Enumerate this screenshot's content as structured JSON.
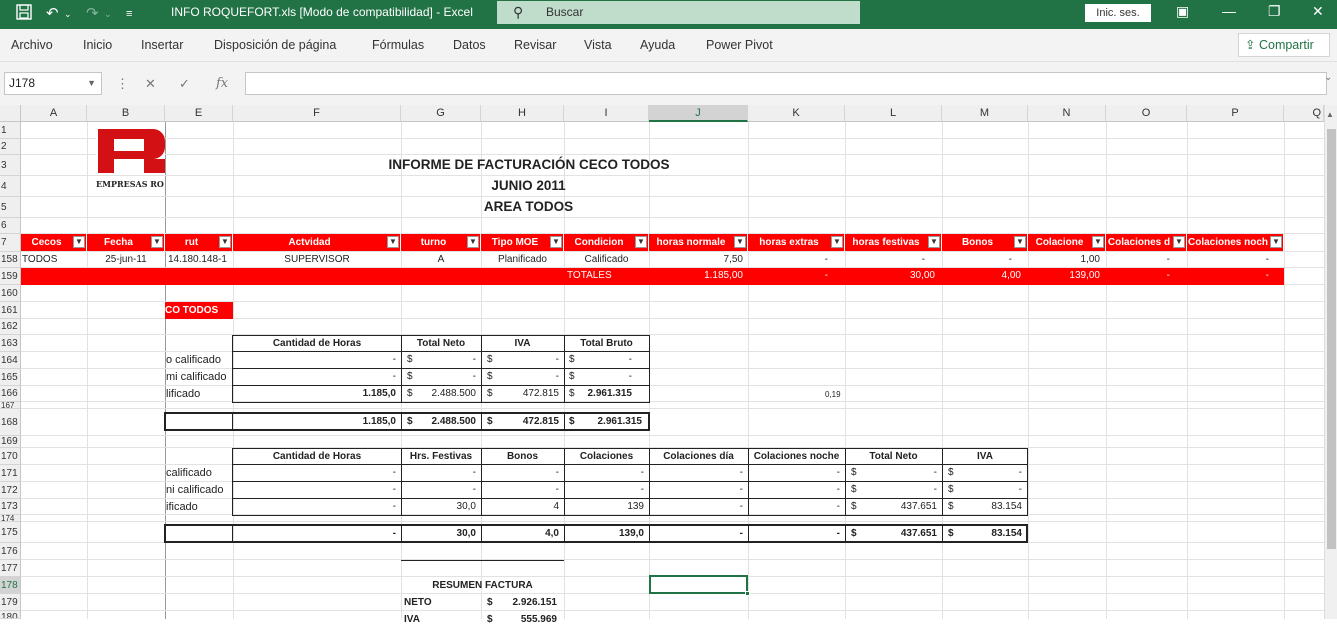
{
  "titlebar": {
    "title": "INFO ROQUEFORT.xls  [Modo de compatibilidad]  -  Excel",
    "search_placeholder": "Buscar",
    "signin": "Inic. ses.",
    "accent": "#217346"
  },
  "menu": [
    "Archivo",
    "Inicio",
    "Insertar",
    "Disposición de página",
    "Fórmulas",
    "Datos",
    "Revisar",
    "Vista",
    "Ayuda",
    "Power Pivot"
  ],
  "share": "Compartir",
  "formula_bar": {
    "cell_ref": "J178",
    "formula": ""
  },
  "columns": [
    "A",
    "B",
    "E",
    "F",
    "G",
    "H",
    "I",
    "J",
    "K",
    "L",
    "M",
    "N",
    "O",
    "P",
    "Q"
  ],
  "rows": [
    "1",
    "2",
    "3",
    "4",
    "5",
    "6",
    "7",
    "158",
    "159",
    "160",
    "161",
    "162",
    "163",
    "164",
    "165",
    "166",
    "167",
    "168",
    "169",
    "170",
    "171",
    "172",
    "173",
    "174",
    "175",
    "176",
    "177",
    "178",
    "179",
    "180"
  ],
  "logo": {
    "letter": "R",
    "text": "EMPRESAS RO"
  },
  "report": {
    "title1": "INFORME DE FACTURACIÓN CECO TODOS",
    "title2": "JUNIO 2011",
    "title3": "AREA TODOS"
  },
  "headers": [
    "Cecos",
    "Fecha",
    "rut",
    "Actvidad",
    "turno",
    "Tipo MOE",
    "Condicion",
    "horas normale",
    "horas extras",
    "horas festivas",
    "Bonos",
    "Colacione",
    "Colaciones d",
    "Colaciones noch"
  ],
  "row158": {
    "ceco": "TODOS",
    "fecha": "25-jun-11",
    "rut": "14.180.148-1",
    "actividad": "SUPERVISOR",
    "turno": "A",
    "tipo": "Planificado",
    "condicion": "Calificado",
    "hn": "7,50",
    "he": "-",
    "hf": "-",
    "bonos": "-",
    "col": "1,00",
    "cold": "-",
    "coln": "-"
  },
  "totales": {
    "label": "TOTALES",
    "hn": "1.185,00",
    "he": "-",
    "hf": "30,00",
    "bonos": "4,00",
    "col": "139,00",
    "cold": "-",
    "coln": "-"
  },
  "ceco_label": "CO TODOS",
  "table1": {
    "headers": [
      "Cantidad de Horas",
      "Total Neto",
      "IVA",
      "Total Bruto"
    ],
    "rows": [
      {
        "label": "o calificado",
        "horas": "-",
        "neto": "-",
        "iva": "-",
        "bruto": "-",
        "bold": false
      },
      {
        "label": "mi calificado",
        "horas": "-",
        "neto": "-",
        "iva": "-",
        "bruto": "-",
        "bold": false
      },
      {
        "label": "lificado",
        "horas": "1.185,0",
        "neto": "2.488.500",
        "iva": "472.815",
        "bruto": "2.961.315",
        "bold": true
      }
    ],
    "rate": "0,19",
    "total": {
      "horas": "1.185,0",
      "neto": "2.488.500",
      "iva": "472.815",
      "bruto": "2.961.315"
    },
    "currency": "$"
  },
  "table2": {
    "headers": [
      "Cantidad de Horas",
      "Hrs. Festivas",
      "Bonos",
      "Colaciones",
      "Colaciones día",
      "Colaciones noche",
      "Total Neto",
      "IVA"
    ],
    "rows": [
      {
        "label": "calificado",
        "horas": "-",
        "fest": "-",
        "bonos": "-",
        "col": "-",
        "cold": "-",
        "coln": "-",
        "neto": "-",
        "iva": "-"
      },
      {
        "label": "ni calificado",
        "horas": "-",
        "fest": "-",
        "bonos": "-",
        "col": "-",
        "cold": "-",
        "coln": "-",
        "neto": "-",
        "iva": "-"
      },
      {
        "label": "ificado",
        "horas": "-",
        "fest": "30,0",
        "bonos": "4",
        "col": "139",
        "cold": "-",
        "coln": "-",
        "neto": "437.651",
        "iva": "83.154"
      }
    ],
    "total": {
      "horas": "-",
      "fest": "30,0",
      "bonos": "4,0",
      "col": "139,0",
      "cold": "-",
      "coln": "-",
      "neto": "437.651",
      "iva": "83.154"
    }
  },
  "resumen": {
    "title": "RESUMEN FACTURA",
    "neto_label": "NETO",
    "neto": "2.926.151",
    "iva_label": "IVA",
    "iva": "555.969"
  }
}
